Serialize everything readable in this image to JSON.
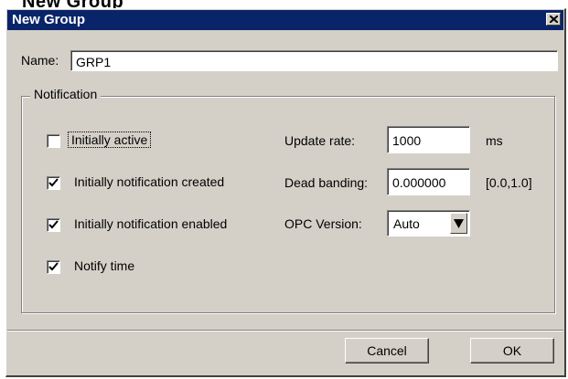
{
  "header_peek": {
    "text": "New Group"
  },
  "window": {
    "title": "New Group"
  },
  "name": {
    "label": "Name:",
    "value": "GRP1"
  },
  "notification": {
    "legend": "Notification",
    "checkboxes": [
      {
        "label": "Initially active",
        "checked": false
      },
      {
        "label": "Initially notification created",
        "checked": true
      },
      {
        "label": "Initially notification enabled",
        "checked": true
      },
      {
        "label": "Notify time",
        "checked": true
      }
    ],
    "update_rate": {
      "label": "Update rate:",
      "value": "1000",
      "unit": "ms"
    },
    "dead_banding": {
      "label": "Dead banding:",
      "value": "0.000000",
      "range": "[0.0,1.0]"
    },
    "opc_version": {
      "label": "OPC Version:",
      "value": "Auto"
    }
  },
  "buttons": {
    "cancel": "Cancel",
    "ok": "OK"
  },
  "colors": {
    "titlebar": "#0a246a",
    "dialog_face": "#d4d0c8",
    "field_bg": "#ffffff"
  }
}
